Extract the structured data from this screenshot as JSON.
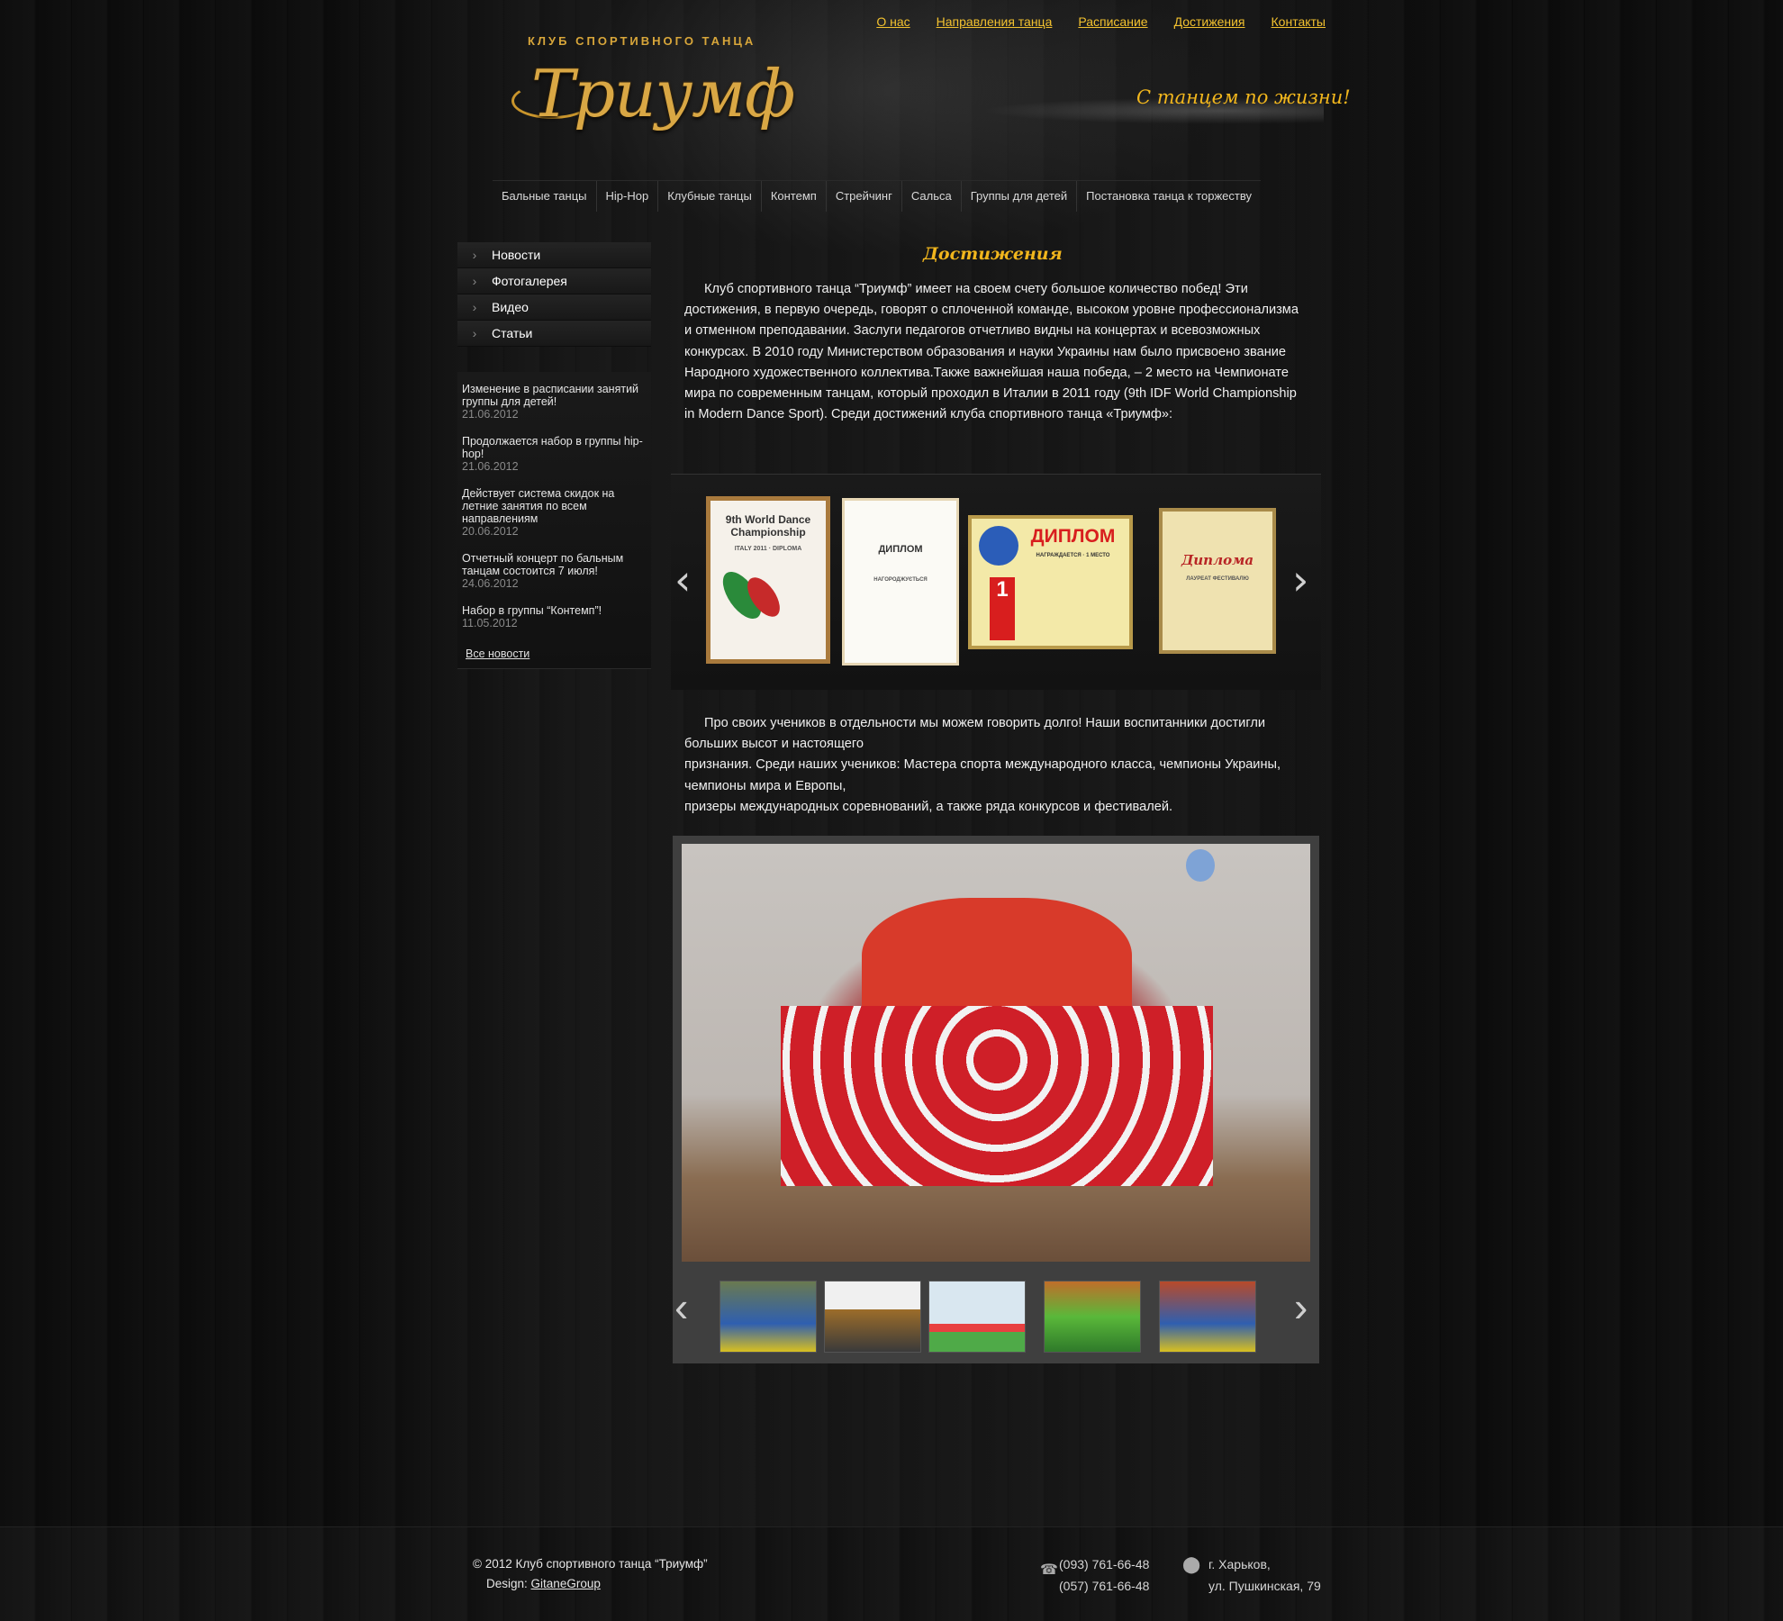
{
  "header": {
    "logo_sub": "Клуб спортивного танца",
    "logo_main": "Триумф",
    "slogan": "С танцем по жизни!",
    "top_nav": [
      "О нас",
      "Направления танца",
      "Расписание",
      "Достижения",
      "Контакты"
    ]
  },
  "main_nav": [
    "Бальные танцы",
    "Hip-Hop",
    "Клубные танцы",
    "Контемп",
    "Стрейчинг",
    "Сальса",
    "Группы для детей",
    "Постановка танца к торжеству"
  ],
  "sidebar": {
    "menu": [
      "Новости",
      "Фотогалерея",
      "Видео",
      "Статьи"
    ],
    "news": [
      {
        "text": "Изменение в расписании занятий группы для детей!",
        "date": "21.06.2012"
      },
      {
        "text": "Продолжается набор в группы hip-hop!",
        "date": "21.06.2012"
      },
      {
        "text": "Действует система скидок на летние занятия по всем направлениям",
        "date": "20.06.2012"
      },
      {
        "text": "Отчетный концерт по бальным танцам состоится 7 июля!",
        "date": "24.06.2012"
      },
      {
        "text": "Набор в группы “Контемп”!",
        "date": "11.05.2012"
      }
    ],
    "all_news": "Все новости"
  },
  "content": {
    "title": "Достижения",
    "para1": "Клуб спортивного танца “Триумф” имеет на своем счету большое количество побед! Эти достижения, в первую очередь, говорят о сплоченной команде, высоком уровне профессионализма и отменном преподавании. Заслуги педагогов отчетливо видны на концертах и всевозможных конкурсах. В 2010 году  Министерством образования и науки Украины нам было присвоено звание Народного художественного коллектива.Также важнейшая наша победа, – 2 место на Чемпионате мира по современным танцам, который проходил в Италии в 2011 году (9th IDF World Championship in Modern Dance Sport).      Среди достижений клуба спортивного танца «Триумф»:",
    "para2_line1": "Про своих учеников в отдельности мы можем говорить долго! Наши воспитанники достигли больших высот и настоящего",
    "para2_line2": "признания. Среди наших учеников: Мастера спорта международного класса, чемпионы Украины, чемпионы мира и Европы,",
    "para2_line3": "призеры международных соревнований, а также ряда конкурсов и фестивалей.",
    "certificates": [
      {
        "title": "9th World Dance Championship",
        "sub": "ITALY 2011 · DIPLOMA"
      },
      {
        "title": "ДИПЛОМ",
        "sub": "НАГОРОДЖУЄТЬСЯ"
      },
      {
        "title": "ДИПЛОМ",
        "sub": "НАГРАЖДАЕТСЯ · 1 МЕСТО"
      },
      {
        "title": "Диплома",
        "sub": "ЛАУРЕАТ ФЕСТИВАЛЮ"
      }
    ]
  },
  "footer": {
    "copyright": "©  2012 Клуб спортивного танца “Триумф”",
    "design_label": "Design:",
    "design_link": "GitaneGroup",
    "phone1": "(093) 761-66-48",
    "phone2": "(057) 761-66-48",
    "city": "г. Харьков,",
    "street": "ул. Пушкинская, 79"
  },
  "colors": {
    "accent_gold": "#f1b61d",
    "nav_yellow": "#f2c12f",
    "background": "#070707",
    "gallery_frame": "#3f3f3f"
  }
}
